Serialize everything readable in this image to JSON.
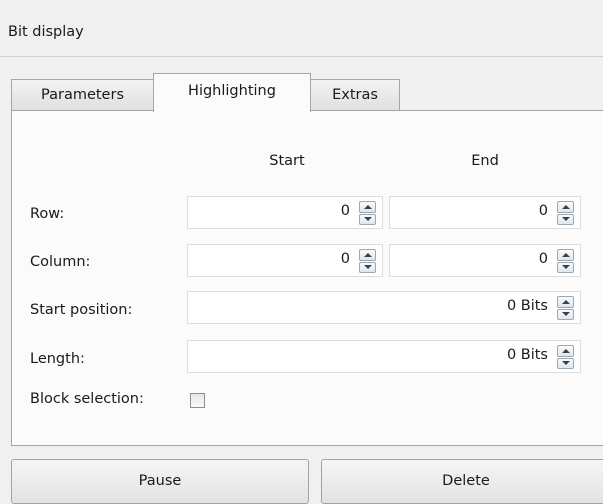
{
  "window": {
    "title": "Bit display"
  },
  "tabs": [
    {
      "label": "Parameters",
      "active": false
    },
    {
      "label": "Highlighting",
      "active": true
    },
    {
      "label": "Extras",
      "active": false
    }
  ],
  "highlighting": {
    "col_start": "Start",
    "col_end": "End",
    "row_label": "Row:",
    "row_start": "0",
    "row_end": "0",
    "column_label": "Column:",
    "column_start": "0",
    "column_end": "0",
    "start_position_label": "Start position:",
    "start_position_value": "0 Bits",
    "length_label": "Length:",
    "length_value": "0 Bits",
    "block_selection_label": "Block selection:",
    "block_selection_checked": false
  },
  "buttons": {
    "pause": "Pause",
    "delete": "Delete"
  }
}
